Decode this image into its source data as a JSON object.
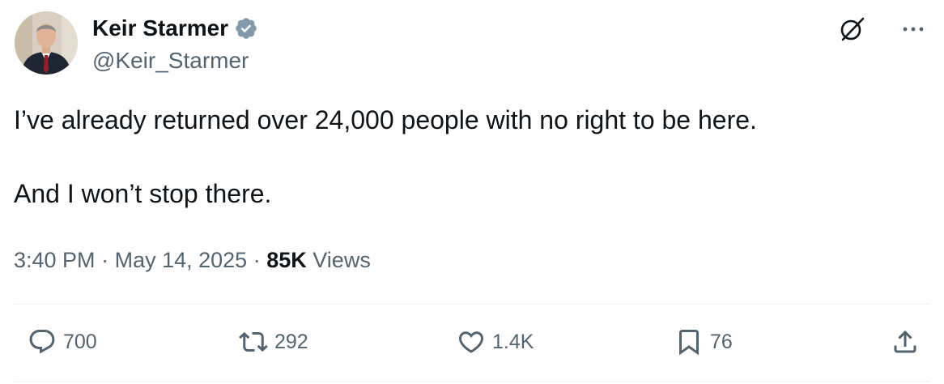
{
  "author": {
    "display_name": "Keir Starmer",
    "handle": "@Keir_Starmer",
    "verified": true
  },
  "tweet": {
    "paragraphs": [
      "I’ve already returned over 24,000 people with no right to be here.",
      "And I won’t stop there."
    ],
    "time": "3:40 PM",
    "separator": "·",
    "date": "May 14, 2025",
    "views_count": "85K",
    "views_label": "Views"
  },
  "actions": {
    "replies": "700",
    "reposts": "292",
    "likes": "1.4K",
    "bookmarks": "76"
  },
  "colors": {
    "text_primary": "#0f1419",
    "text_secondary": "#536471",
    "divider": "#eff3f4",
    "verified_badge": "#829aab"
  },
  "icons": [
    "grok-icon",
    "more-icon",
    "reply-icon",
    "repost-icon",
    "like-icon",
    "bookmark-icon",
    "share-icon",
    "verified-badge-icon"
  ]
}
